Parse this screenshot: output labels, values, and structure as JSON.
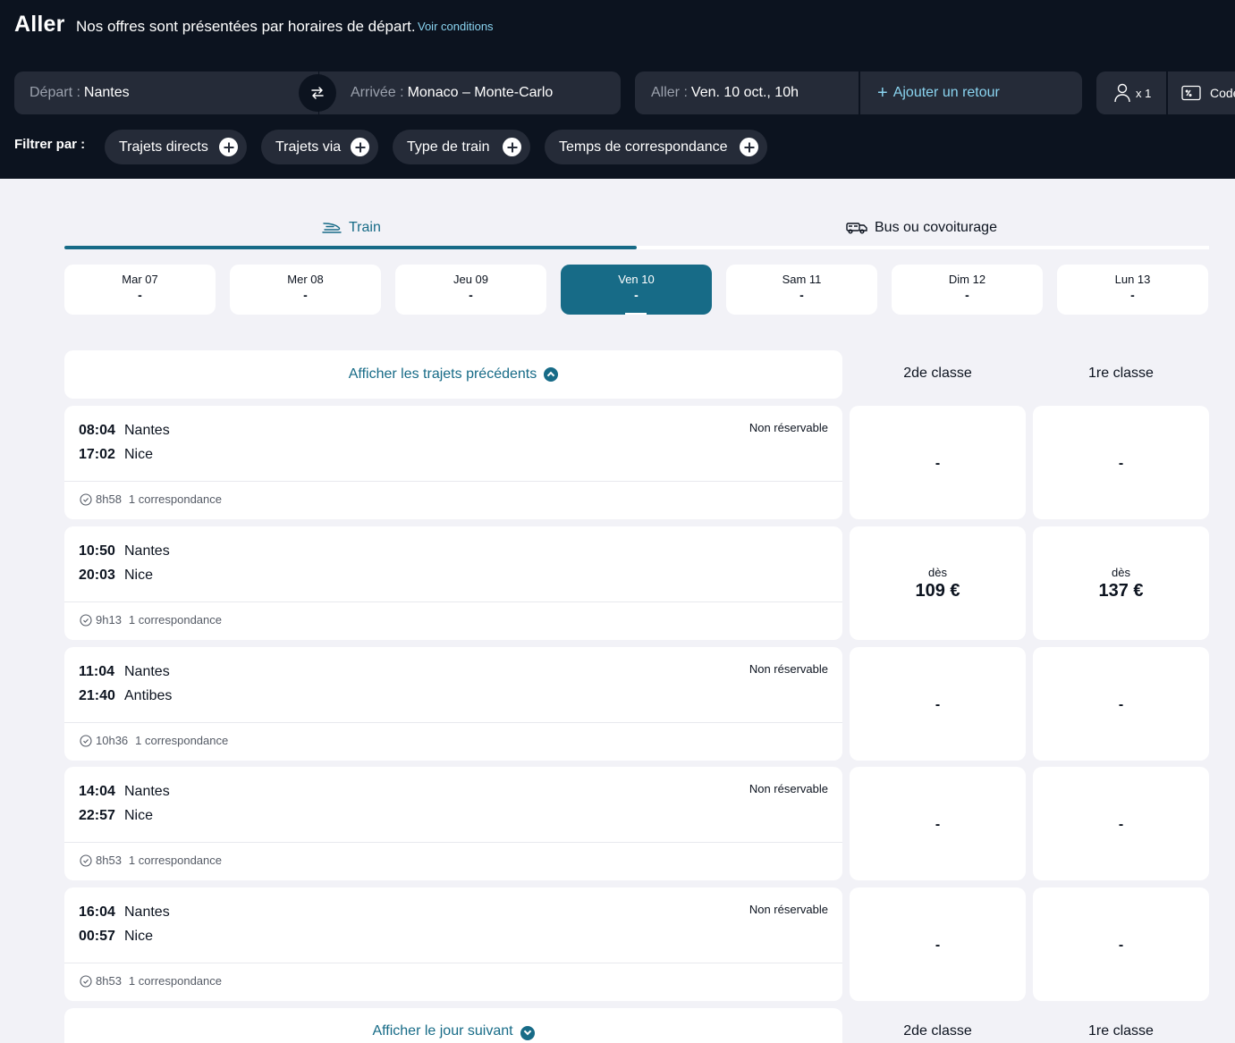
{
  "header": {
    "title": "Aller",
    "subtitle": "Nos offres sont présentées par horaires de départ.",
    "conditions_link": "Voir conditions"
  },
  "search": {
    "departure_label": "Départ :",
    "departure_value": "Nantes",
    "arrival_label": "Arrivée :",
    "arrival_value": "Monaco – Monte-Carlo",
    "date_label": "Aller :",
    "date_value": "Ven. 10 oct., 10h",
    "add_return": "Ajouter un retour",
    "passengers": "x 1",
    "code_label": "Code"
  },
  "filters": {
    "label": "Filtrer par :",
    "items": [
      "Trajets directs",
      "Trajets via",
      "Type de train",
      "Temps de correspondance"
    ]
  },
  "tabs": [
    {
      "label": "Train",
      "active": true
    },
    {
      "label": "Bus ou covoiturage",
      "active": false
    }
  ],
  "dates": [
    {
      "label": "Mar 07",
      "value": "-"
    },
    {
      "label": "Mer 08",
      "value": "-"
    },
    {
      "label": "Jeu 09",
      "value": "-"
    },
    {
      "label": "Ven 10",
      "value": "-",
      "active": true
    },
    {
      "label": "Sam 11",
      "value": "-"
    },
    {
      "label": "Dim 12",
      "value": "-"
    },
    {
      "label": "Lun 13",
      "value": "-"
    }
  ],
  "results": {
    "show_previous": "Afficher les trajets précédents",
    "show_next_day": "Afficher le jour suivant",
    "class_2": "2de classe",
    "class_1": "1re classe",
    "trips": [
      {
        "dep_time": "08:04",
        "dep_city": "Nantes",
        "arr_time": "17:02",
        "arr_city": "Nice",
        "tag": "Non réservable",
        "duration": "8h58",
        "connections": "1 correspondance",
        "price_2": "-",
        "price_1": "-"
      },
      {
        "dep_time": "10:50",
        "dep_city": "Nantes",
        "arr_time": "20:03",
        "arr_city": "Nice",
        "tag": "",
        "duration": "9h13",
        "connections": "1 correspondance",
        "from_label": "dès",
        "price_2": "109 €",
        "price_1": "137 €"
      },
      {
        "dep_time": "11:04",
        "dep_city": "Nantes",
        "arr_time": "21:40",
        "arr_city": "Antibes",
        "tag": "Non réservable",
        "duration": "10h36",
        "connections": "1 correspondance",
        "price_2": "-",
        "price_1": "-"
      },
      {
        "dep_time": "14:04",
        "dep_city": "Nantes",
        "arr_time": "22:57",
        "arr_city": "Nice",
        "tag": "Non réservable",
        "duration": "8h53",
        "connections": "1 correspondance",
        "price_2": "-",
        "price_1": "-"
      },
      {
        "dep_time": "16:04",
        "dep_city": "Nantes",
        "arr_time": "00:57",
        "arr_city": "Nice",
        "tag": "Non réservable",
        "duration": "8h53",
        "connections": "1 correspondance",
        "price_2": "-",
        "price_1": "-"
      }
    ]
  },
  "colors": {
    "header_bg": "#0c131f",
    "field_bg": "#252b38",
    "accent": "#176b87",
    "link": "#8ad4f0",
    "page_bg": "#f2f2f7"
  }
}
